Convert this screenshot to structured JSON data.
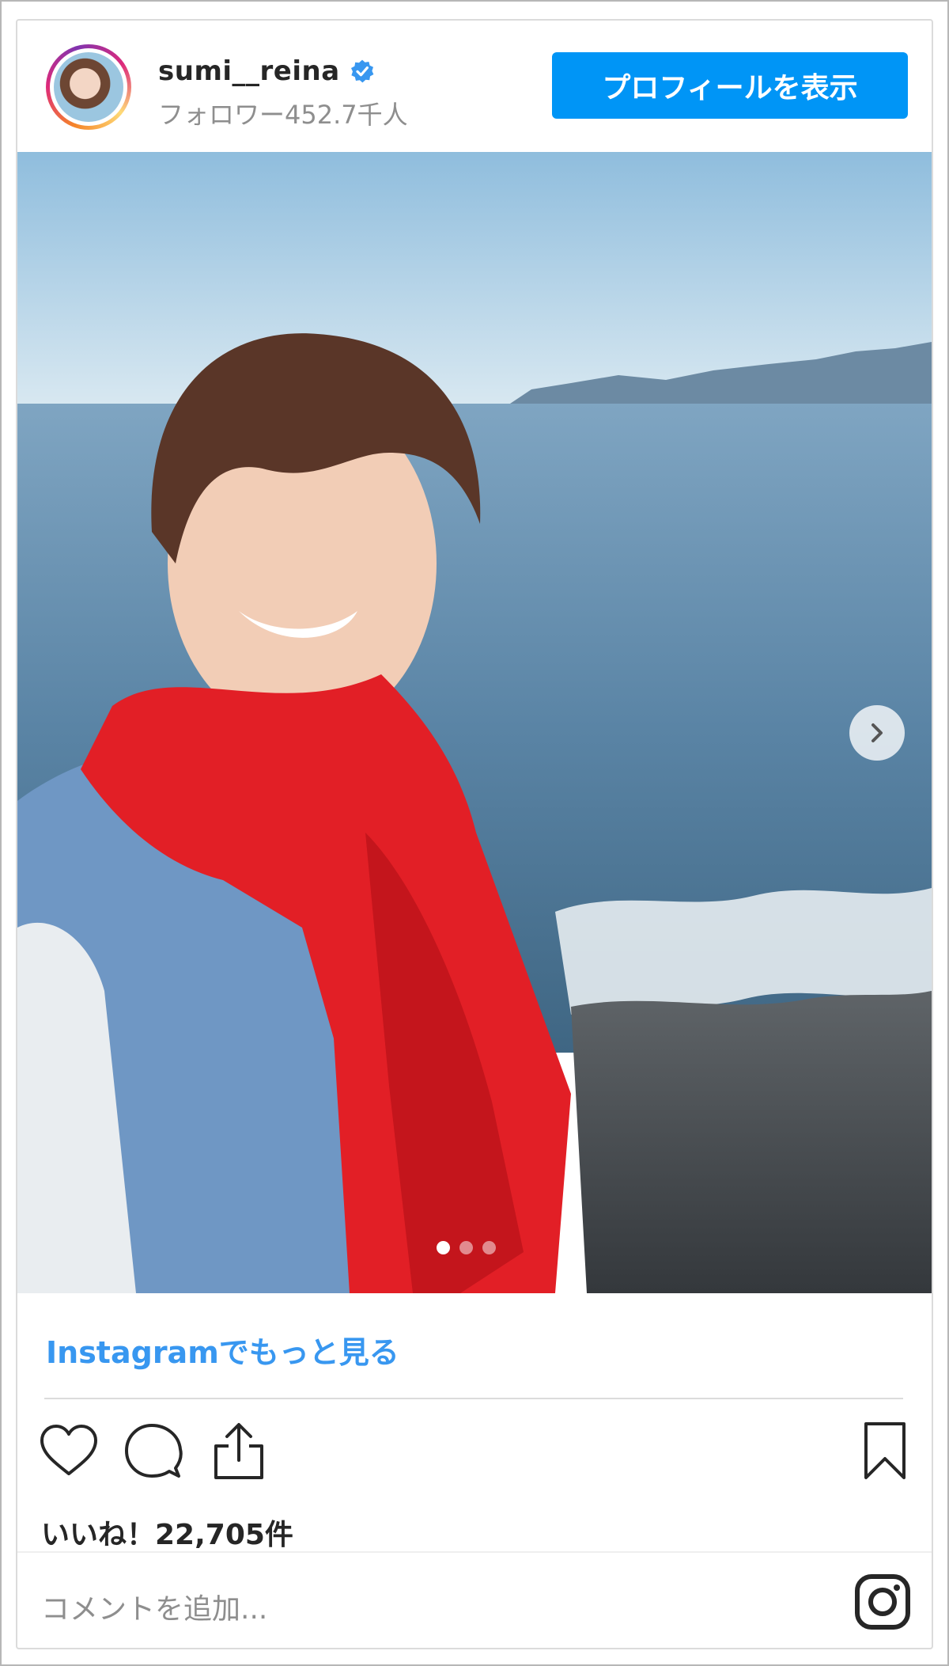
{
  "header": {
    "username": "sumi__reina",
    "followers": "フォロワー452.7千人",
    "profile_button": "プロフィールを表示"
  },
  "carousel": {
    "slide_count": 3,
    "active_slide": 1
  },
  "footer": {
    "more_link": "Instagramでもっと見る",
    "likes": "いいね！22,705件",
    "comment_placeholder": "コメントを追加..."
  },
  "colors": {
    "accent": "#0095f6",
    "link": "#3897f0",
    "scarf": "#e21f26",
    "sky": "#aacde4",
    "sea": "#5c89aa"
  },
  "icons": [
    "verified-badge-icon",
    "chevron-right-icon",
    "heart-icon",
    "comment-icon",
    "share-icon",
    "bookmark-icon",
    "instagram-icon"
  ]
}
